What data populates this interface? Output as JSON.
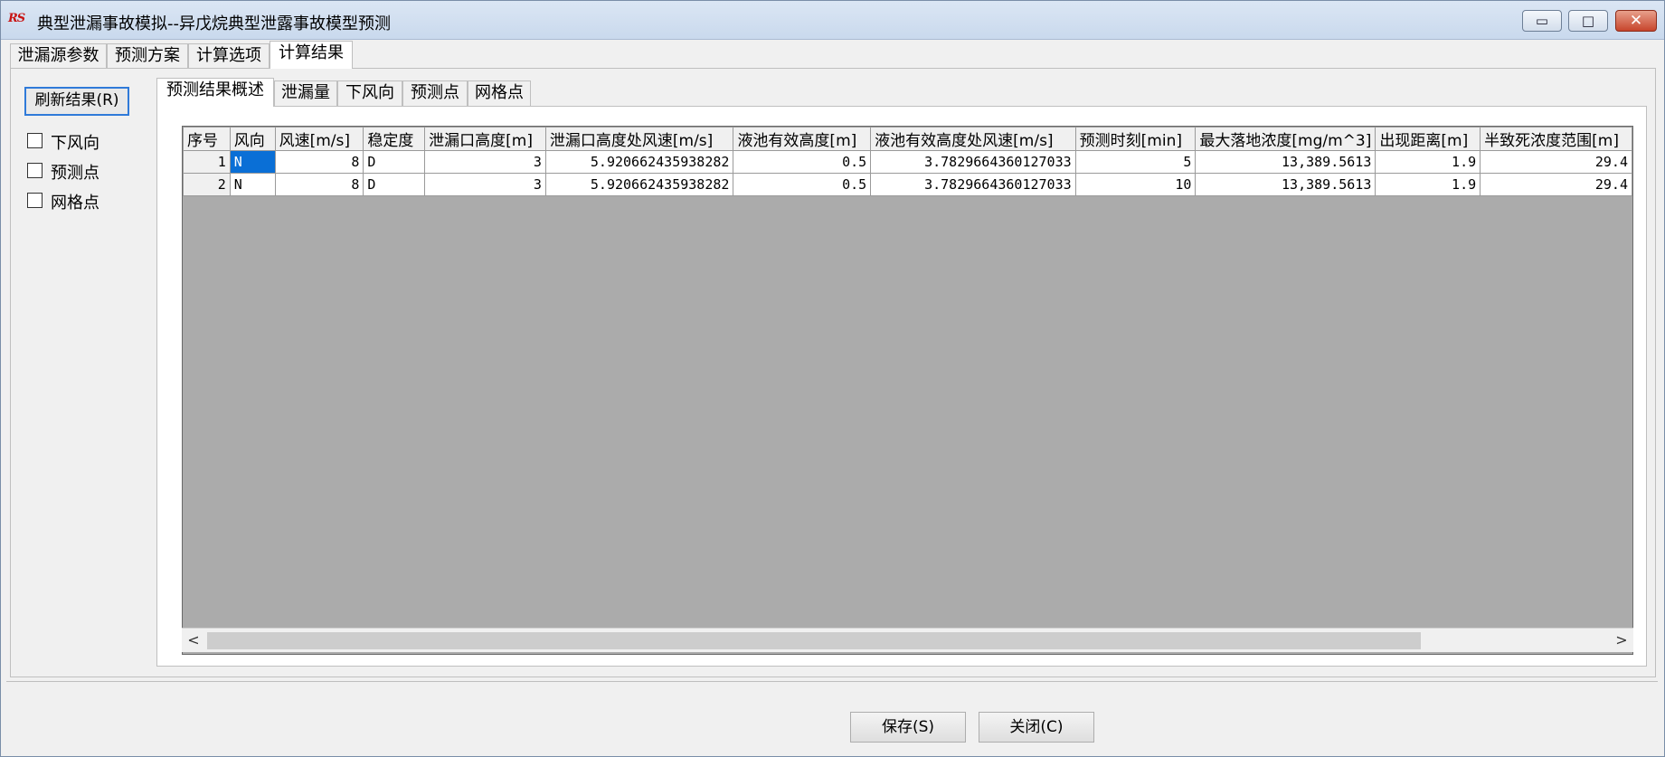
{
  "window": {
    "title": "典型泄漏事故模拟--异戊烷典型泄露事故模型预测",
    "app_icon_text": "RS",
    "controls": {
      "minimize": "▭",
      "maximize": "□",
      "close": "✕"
    }
  },
  "top_tabs": [
    "泄漏源参数",
    "预测方案",
    "计算选项",
    "计算结果"
  ],
  "left": {
    "refresh_label": "刷新结果(R)",
    "checkboxes": [
      "下风向",
      "预测点",
      "网格点"
    ]
  },
  "inner_tabs": [
    "预测结果概述",
    "泄漏量",
    "下风向",
    "预测点",
    "网格点"
  ],
  "table": {
    "columns": [
      "序号",
      "风向",
      "风速[m/s]",
      "稳定度",
      "泄漏口高度[m]",
      "泄漏口高度处风速[m/s]",
      "液池有效高度[m]",
      "液池有效高度处风速[m/s]",
      "预测时刻[min]",
      "最大落地浓度[mg/m^3]",
      "出现距离[m]",
      "半致死浓度范围[m]"
    ],
    "rows": [
      [
        "1",
        "N",
        "8",
        "D",
        "3",
        "5.920662435938282",
        "0.5",
        "3.7829664360127033",
        "5",
        "13,389.5613",
        "1.9",
        "29.4"
      ],
      [
        "2",
        "N",
        "8",
        "D",
        "3",
        "5.920662435938282",
        "0.5",
        "3.7829664360127033",
        "10",
        "13,389.5613",
        "1.9",
        "29.4"
      ]
    ]
  },
  "scrollbar": {
    "left_arrow": "<",
    "right_arrow": ">"
  },
  "buttons": {
    "save": "保存(S)",
    "close": "关闭(C)"
  }
}
